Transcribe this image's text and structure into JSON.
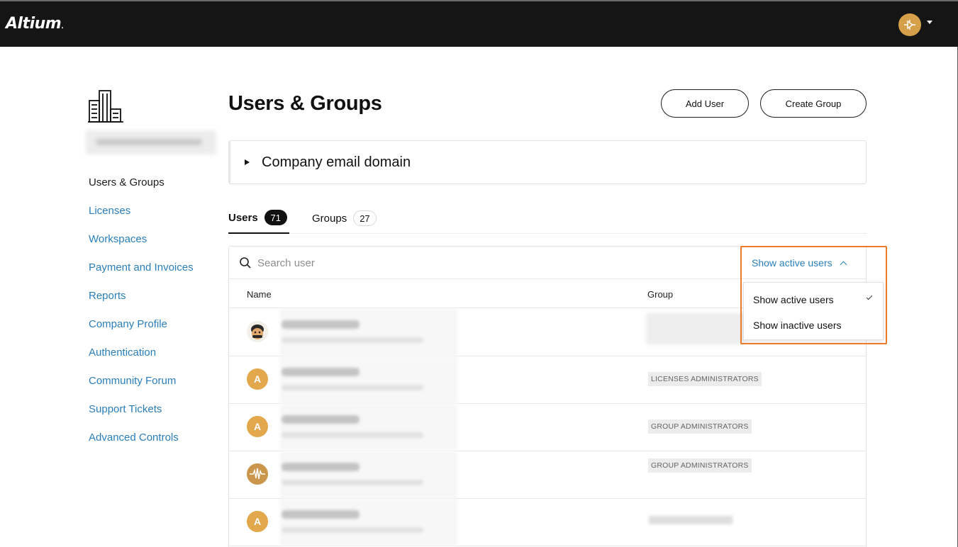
{
  "app": {
    "logo": "Altium",
    "logo_mark": "."
  },
  "sidebar": {
    "items": [
      {
        "label": "Users & Groups",
        "active": true
      },
      {
        "label": "Licenses"
      },
      {
        "label": "Workspaces"
      },
      {
        "label": "Payment and Invoices"
      },
      {
        "label": "Reports"
      },
      {
        "label": "Company Profile"
      },
      {
        "label": "Authentication"
      },
      {
        "label": "Community Forum"
      },
      {
        "label": "Support Tickets"
      },
      {
        "label": "Advanced Controls"
      }
    ]
  },
  "main": {
    "title": "Users & Groups",
    "add_user_label": "Add User",
    "create_group_label": "Create Group",
    "domain_panel_label": "Company email domain",
    "tabs": [
      {
        "label": "Users",
        "count": "71"
      },
      {
        "label": "Groups",
        "count": "27"
      }
    ],
    "search": {
      "placeholder": "Search user"
    },
    "columns": {
      "name": "Name",
      "group": "Group"
    },
    "rows": [
      {
        "avatar": "photo",
        "group": ""
      },
      {
        "avatar": "A",
        "group": "LICENSES ADMINISTRATORS"
      },
      {
        "avatar": "A",
        "group": "GROUP ADMINISTRATORS"
      },
      {
        "avatar": "wave",
        "group": "GROUP ADMINISTRATORS"
      },
      {
        "avatar": "A",
        "group": ""
      }
    ]
  },
  "filter": {
    "selected_label": "Show active users",
    "options": [
      "Show active users",
      "Show inactive users"
    ]
  },
  "colors": {
    "accent": "#2a7fba",
    "highlight": "#ec7a2c",
    "avatar": "#e3a84b",
    "topbar": "#151515"
  }
}
